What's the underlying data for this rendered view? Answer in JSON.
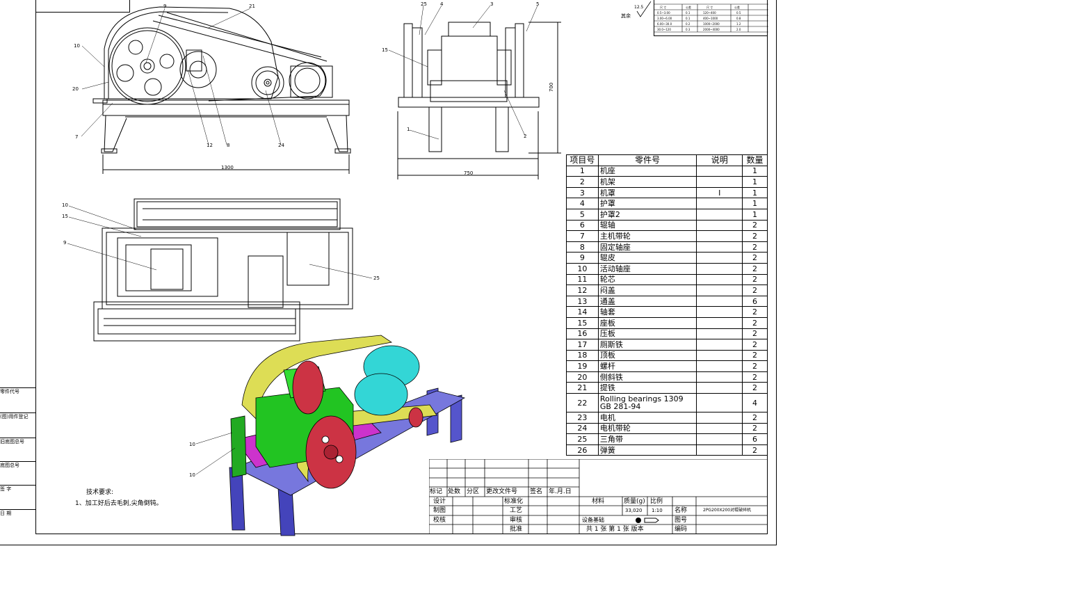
{
  "bom": {
    "headers": {
      "item": "项目号",
      "part": "零件号",
      "desc": "说明",
      "qty": "数量"
    },
    "rows": [
      {
        "no": "1",
        "name": "机座",
        "desc": "",
        "qty": "1"
      },
      {
        "no": "2",
        "name": "机架",
        "desc": "",
        "qty": "1"
      },
      {
        "no": "3",
        "name": "机罩",
        "desc": "I",
        "qty": "1"
      },
      {
        "no": "4",
        "name": "护罩",
        "desc": "",
        "qty": "1"
      },
      {
        "no": "5",
        "name": "护罩2",
        "desc": "",
        "qty": "1"
      },
      {
        "no": "6",
        "name": "辊轴",
        "desc": "",
        "qty": "2"
      },
      {
        "no": "7",
        "name": "主机带轮",
        "desc": "",
        "qty": "2"
      },
      {
        "no": "8",
        "name": "固定轴座",
        "desc": "",
        "qty": "2"
      },
      {
        "no": "9",
        "name": "辊皮",
        "desc": "",
        "qty": "2"
      },
      {
        "no": "10",
        "name": "活动轴座",
        "desc": "",
        "qty": "2"
      },
      {
        "no": "11",
        "name": "轮芯",
        "desc": "",
        "qty": "2"
      },
      {
        "no": "12",
        "name": "闷盖",
        "desc": "",
        "qty": "2"
      },
      {
        "no": "13",
        "name": "通盖",
        "desc": "",
        "qty": "6"
      },
      {
        "no": "14",
        "name": "轴套",
        "desc": "",
        "qty": "2"
      },
      {
        "no": "15",
        "name": "座板",
        "desc": "",
        "qty": "2"
      },
      {
        "no": "16",
        "name": "压板",
        "desc": "",
        "qty": "2"
      },
      {
        "no": "17",
        "name": "厕斯铁",
        "desc": "",
        "qty": "2"
      },
      {
        "no": "18",
        "name": "顶板",
        "desc": "",
        "qty": "2"
      },
      {
        "no": "19",
        "name": "螺杆",
        "desc": "",
        "qty": "2"
      },
      {
        "no": "20",
        "name": "侧斜铁",
        "desc": "",
        "qty": "2"
      },
      {
        "no": "21",
        "name": "提铁",
        "desc": "",
        "qty": "2"
      },
      {
        "no": "22",
        "name": "Rolling bearings 1309 GB 281-94",
        "desc": "",
        "qty": "4"
      },
      {
        "no": "23",
        "name": "电机",
        "desc": "",
        "qty": "2"
      },
      {
        "no": "24",
        "name": "电机带轮",
        "desc": "",
        "qty": "2"
      },
      {
        "no": "25",
        "name": "三角带",
        "desc": "",
        "qty": "6"
      },
      {
        "no": "26",
        "name": "弹簧",
        "desc": "",
        "qty": "2"
      }
    ]
  },
  "title_block": {
    "row_labels": [
      "标记",
      "处数",
      "分区",
      "更改文件号",
      "签名",
      "年.月.日"
    ],
    "design": "设计",
    "standardize": "标准化",
    "draw": "制图",
    "process": "工艺",
    "check": "校核",
    "review": "审核",
    "approve": "批准",
    "material": "材料",
    "mass": "质量(g)",
    "scale": "比例",
    "mass_value": "33,020",
    "scale_value": "1:10",
    "name_label": "名称",
    "name_value": "2PG200X200对辊破碎机",
    "drawing_no_label": "图号",
    "code_label": "编码",
    "sheets": "共 1 张  第 1 张  版本",
    "equipment": "设备基础"
  },
  "side_strip": [
    "零件代号",
    "(图)用件登记",
    "旧底图总号",
    "底图总号",
    "签  字",
    "日  期"
  ],
  "tech": {
    "title": "技术要求:",
    "item1": "1、加工好后去毛刺,尖角倒钝。"
  },
  "dims": {
    "width_front": "1300",
    "width_side": "750",
    "height_side": "700"
  },
  "roughness": {
    "label": "其余",
    "value": "12.5",
    "header": "公差等级"
  },
  "balloons_front": [
    "10",
    "20",
    "7",
    "9",
    "21",
    "12",
    "8",
    "24"
  ],
  "balloons_side": [
    "25",
    "4",
    "3",
    "5",
    "15",
    "1",
    "2"
  ],
  "balloons_top": [
    "10",
    "15",
    "9",
    "25"
  ],
  "balloons_iso": [
    "10",
    "10"
  ],
  "colors": {
    "frame": "#5555cc",
    "hopper": "#22c422",
    "motor": "#33d6d6",
    "pulley": "#cc3344",
    "belt_guard": "#dddd55",
    "base_purple": "#cc33cc"
  }
}
